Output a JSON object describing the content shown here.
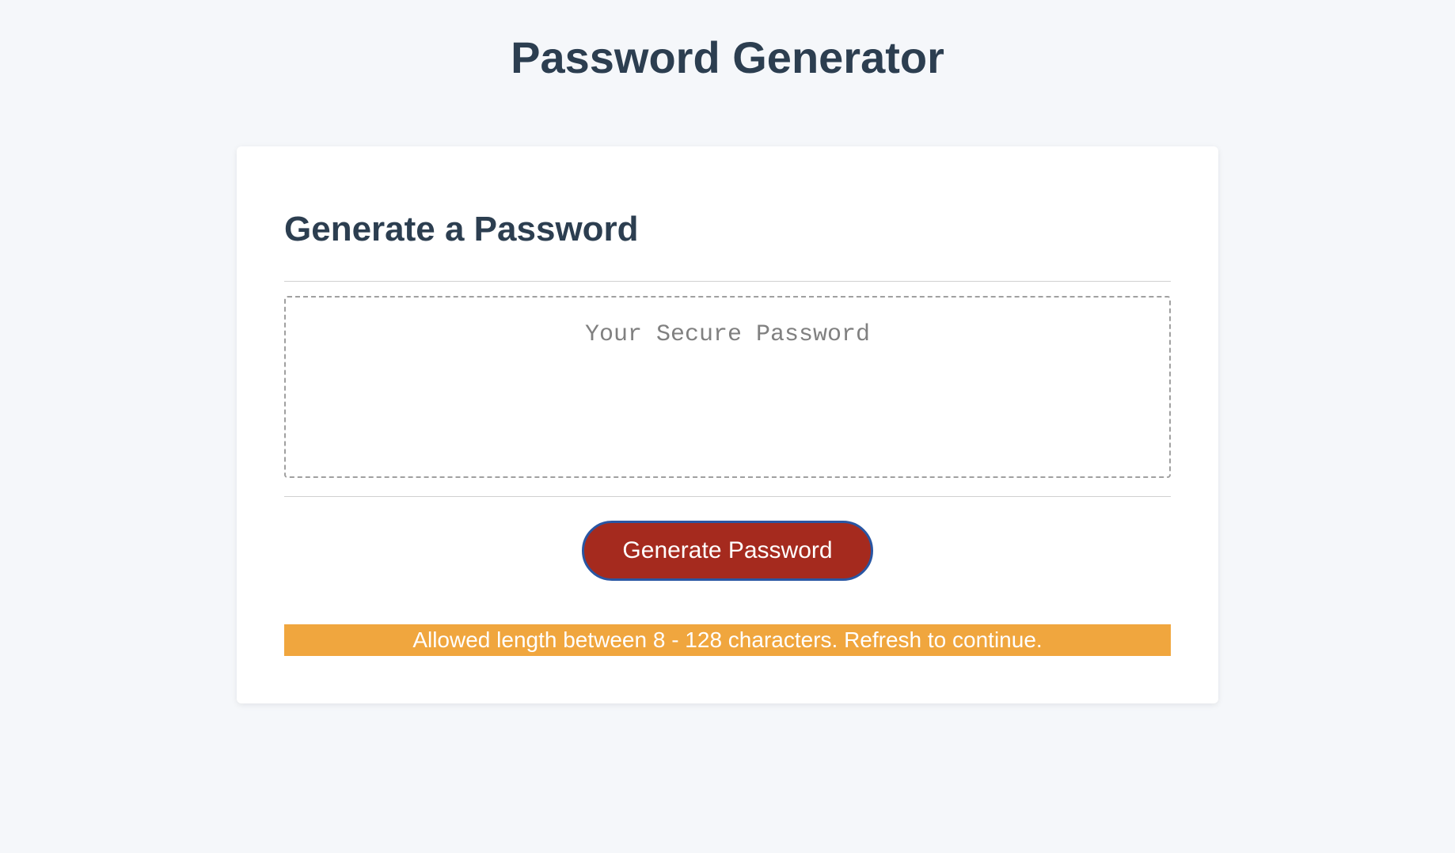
{
  "header": {
    "title": "Password Generator"
  },
  "card": {
    "title": "Generate a Password",
    "password_placeholder": "Your Secure Password",
    "password_value": "",
    "generate_button_label": "Generate Password",
    "alert_message": "Allowed length between 8 - 128 characters. Refresh to continue."
  }
}
